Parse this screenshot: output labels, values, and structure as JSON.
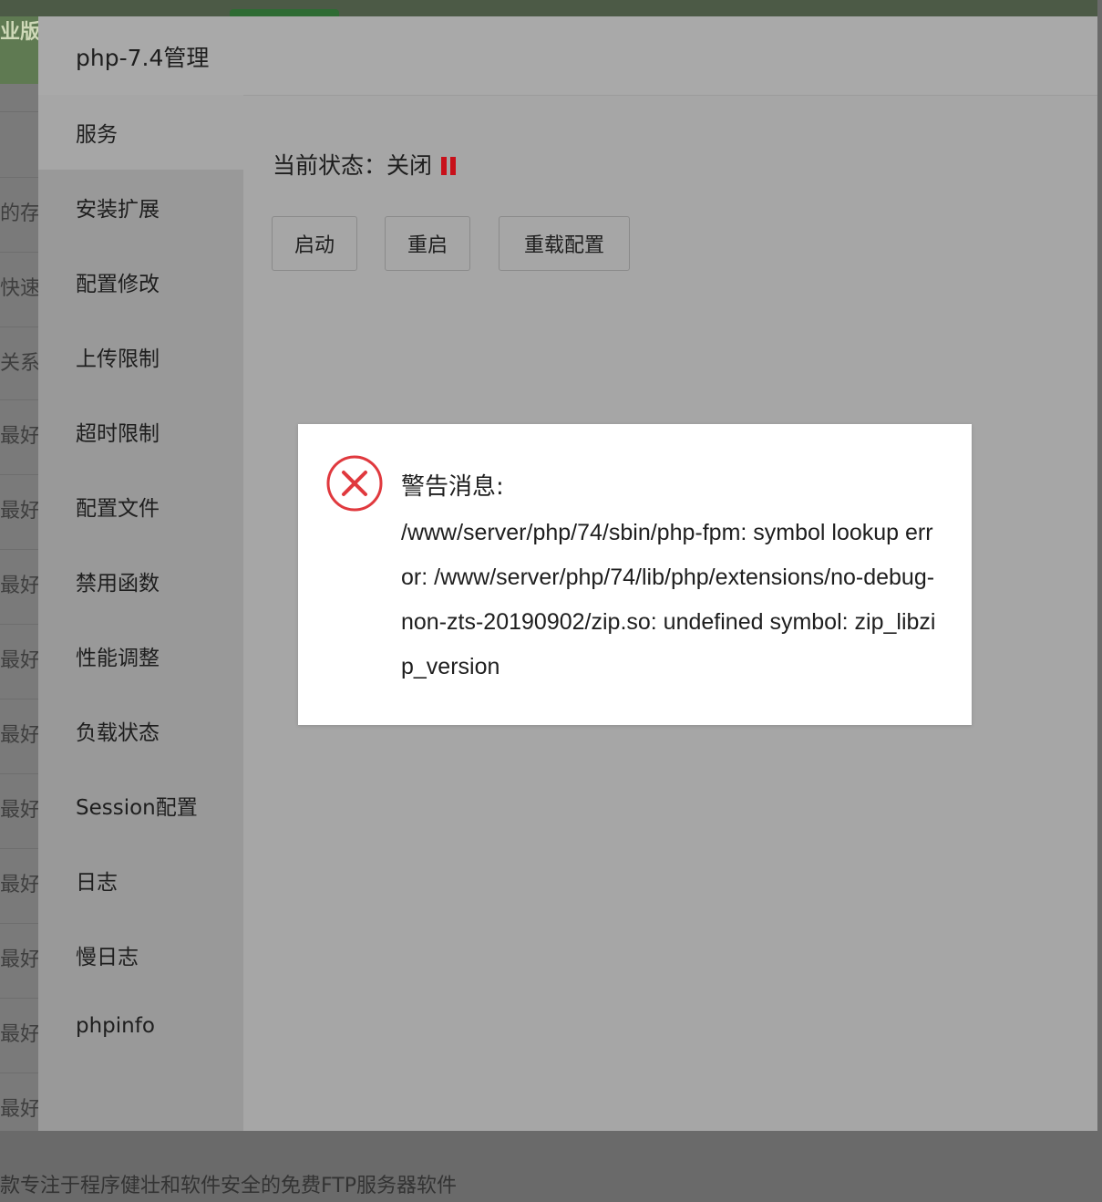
{
  "background": {
    "brand_fragment": "业版",
    "row_fragments": [
      "",
      "的存储",
      "快速",
      "关系",
      "最好的",
      "最好的",
      "最好的",
      "最好的",
      "最好的",
      "最好的",
      "最好的",
      "最好的",
      "最好的",
      "最好的"
    ],
    "footer_text": "款专注于程序健壮和软件安全的免费FTP服务器软件"
  },
  "dialog": {
    "title": "php-7.4管理",
    "sidebar": {
      "items": [
        {
          "label": "服务",
          "active": true
        },
        {
          "label": "安装扩展"
        },
        {
          "label": "配置修改"
        },
        {
          "label": "上传限制"
        },
        {
          "label": "超时限制"
        },
        {
          "label": "配置文件"
        },
        {
          "label": "禁用函数"
        },
        {
          "label": "性能调整"
        },
        {
          "label": "负载状态"
        },
        {
          "label": "Session配置"
        },
        {
          "label": "日志"
        },
        {
          "label": "慢日志"
        },
        {
          "label": "phpinfo"
        }
      ]
    },
    "service": {
      "status_label": "当前状态：",
      "status_value": "关闭",
      "status_icon": "pause-icon",
      "status_color": "#c8101a",
      "buttons": {
        "start": "启动",
        "restart": "重启",
        "reload": "重载配置"
      }
    }
  },
  "message": {
    "icon": "error-circle-icon",
    "icon_color": "#e0393e",
    "title": "警告消息:",
    "body": "/www/server/php/74/sbin/php-fpm: symbol lookup error: /www/server/php/74/lib/php/extensions/no-debug-non-zts-20190902/zip.so: undefined symbol: zip_libzip_version"
  }
}
